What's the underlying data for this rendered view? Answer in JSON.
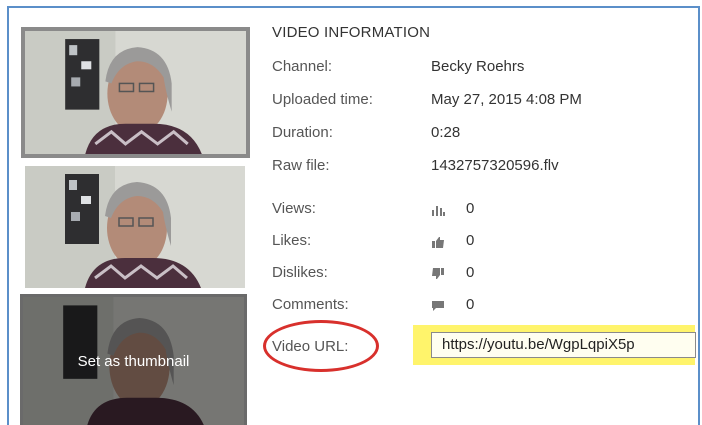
{
  "section_title": "VIDEO INFORMATION",
  "fields": [
    {
      "label": "Channel:",
      "value": "Becky Roehrs"
    },
    {
      "label": "Uploaded time:",
      "value": "May 27, 2015 4:08 PM"
    },
    {
      "label": "Duration:",
      "value": "0:28"
    },
    {
      "label": "Raw file:",
      "value": "1432757320596.flv"
    }
  ],
  "stats": [
    {
      "label": "Views:",
      "icon": "bar-chart-icon",
      "value": "0"
    },
    {
      "label": "Likes:",
      "icon": "thumbs-up-icon",
      "value": "0"
    },
    {
      "label": "Dislikes:",
      "icon": "thumbs-down-icon",
      "value": "0"
    },
    {
      "label": "Comments:",
      "icon": "comment-icon",
      "value": "0"
    }
  ],
  "video_url": {
    "label": "Video URL:",
    "value": "https://youtu.be/WgpLqpiX5p"
  },
  "thumbnail_overlay_label": "Set as thumbnail",
  "colors": {
    "frame": "#5b8fc9",
    "highlight": "#fff46b",
    "annotation": "#d8302c"
  }
}
